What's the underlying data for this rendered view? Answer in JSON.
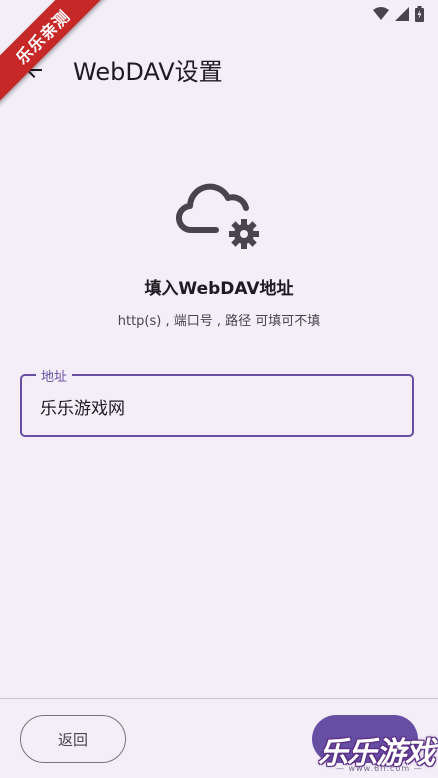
{
  "status_bar": {
    "time": "",
    "icons": [
      "wifi-icon",
      "signal-icon",
      "battery-icon"
    ]
  },
  "app_bar": {
    "title": "WebDAV设置",
    "back_icon": "arrow-back-icon"
  },
  "content": {
    "icon": "cloud-settings-icon",
    "heading": "填入WebDAV地址",
    "hint": "http(s) , 端口号 , 路径 可填可不填"
  },
  "address_field": {
    "label": "地址",
    "value": "乐乐游戏网"
  },
  "footer": {
    "back_label": "返回"
  },
  "overlays": {
    "ribbon_text": "乐乐亲测",
    "watermark_text": "乐乐游戏",
    "watermark_url": "— www.6ll.com —"
  },
  "colors": {
    "background": "#f3eef8",
    "accent": "#6750a4",
    "ribbon": "#c62828"
  }
}
